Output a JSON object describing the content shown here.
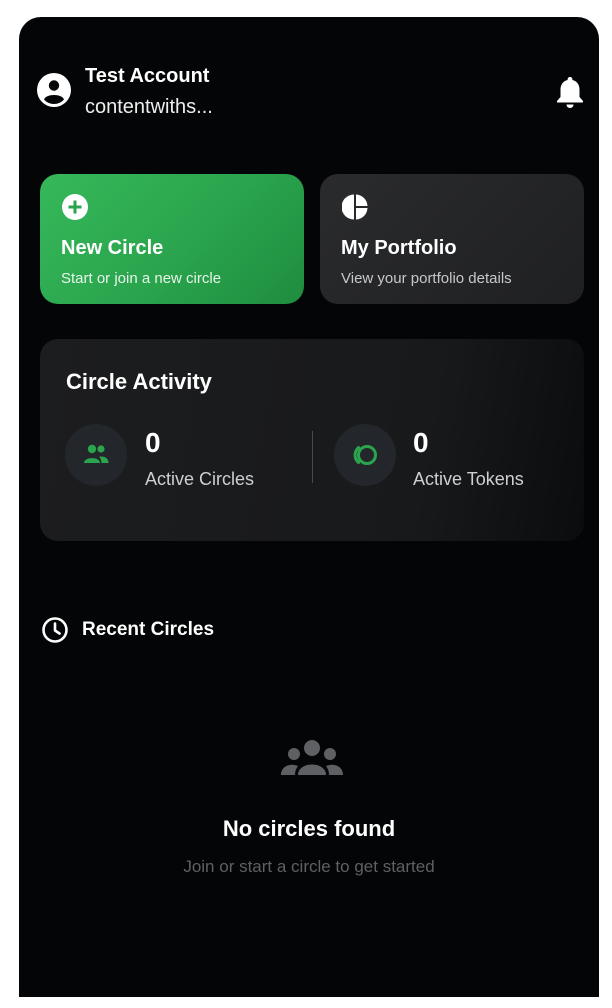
{
  "account": {
    "name": "Test Account",
    "email": "contentwiths..."
  },
  "actions": {
    "new_circle": {
      "title": "New Circle",
      "subtitle": "Start or join a new circle",
      "icon": "plus-circle-icon"
    },
    "portfolio": {
      "title": "My Portfolio",
      "subtitle": "View your portfolio details",
      "icon": "pie-chart-icon"
    }
  },
  "activity": {
    "title": "Circle Activity",
    "active_circles": {
      "value": "0",
      "label": "Active Circles",
      "icon": "group-icon"
    },
    "active_tokens": {
      "value": "0",
      "label": "Active Tokens",
      "icon": "token-icon"
    }
  },
  "recent": {
    "title": "Recent Circles",
    "icon": "clock-icon",
    "empty_title": "No circles found",
    "empty_subtitle": "Join or start a circle to get started"
  },
  "colors": {
    "accent": "#2aa44d",
    "background": "#040506",
    "card_dark": "#1f2022"
  }
}
